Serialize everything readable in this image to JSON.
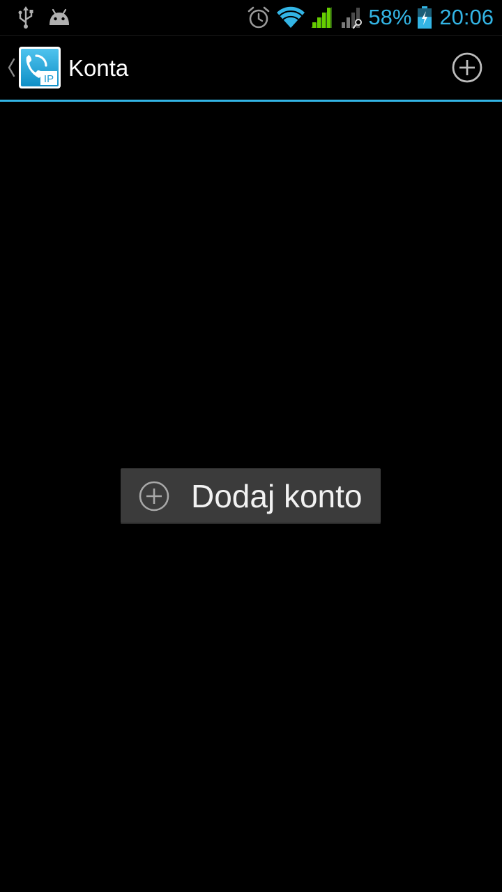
{
  "status_bar": {
    "left_icons": [
      "usb-icon",
      "android-debug-icon"
    ],
    "right_icons": [
      "alarm-icon",
      "wifi-icon",
      "signal-icon",
      "signal-searching-icon",
      "battery-charging-icon"
    ],
    "battery_percent": "58%",
    "battery_level": 0.58,
    "time": "20:06",
    "accent_color": "#33b5e5"
  },
  "action_bar": {
    "title": "Konta",
    "app_icon": "voip-phone-ip-icon",
    "up_icon": "chevron-back-icon",
    "add_icon": "plus-circle-icon",
    "divider_color": "#33b5e5"
  },
  "content": {
    "add_account_button": {
      "label": "Dodaj konto",
      "icon": "plus-circle-icon",
      "background": "#3b3b3b"
    }
  }
}
